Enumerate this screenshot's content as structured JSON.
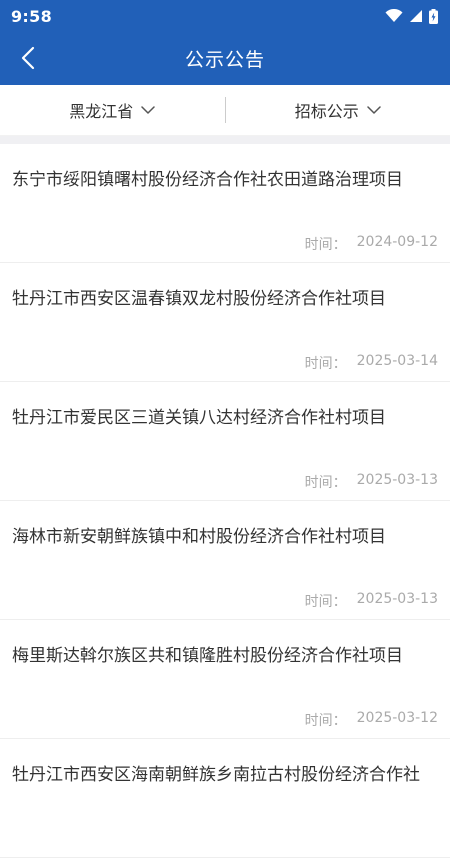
{
  "status_bar": {
    "time": "9:58",
    "icons": [
      "wifi-icon",
      "cell-signal-icon",
      "battery-icon"
    ]
  },
  "app_bar": {
    "title": "公示公告",
    "back_icon": "chevron-left-icon"
  },
  "filters": {
    "region": "黑龙江省",
    "category": "招标公示",
    "dropdown_icon": "chevron-down-icon"
  },
  "notices": {
    "time_label": "时间：",
    "items": [
      {
        "title": "东宁市绥阳镇曙村股份经济合作社农田道路治理项目",
        "date": "2024-09-12"
      },
      {
        "title": "牡丹江市西安区温春镇双龙村股份经济合作社项目",
        "date": "2025-03-14"
      },
      {
        "title": "牡丹江市爱民区三道关镇八达村经济合作社村项目",
        "date": "2025-03-13"
      },
      {
        "title": "海林市新安朝鲜族镇中和村股份经济合作社村项目",
        "date": "2025-03-13"
      },
      {
        "title": "梅里斯达斡尔族区共和镇隆胜村股份经济合作社项目",
        "date": "2025-03-12"
      },
      {
        "title": "牡丹江市西安区海南朝鲜族乡南拉古村股份经济合作社",
        "date": ""
      }
    ]
  },
  "colors": {
    "primary": "#2160b8",
    "meta_text": "#aaaaaa",
    "band": "#f0f0f3"
  }
}
